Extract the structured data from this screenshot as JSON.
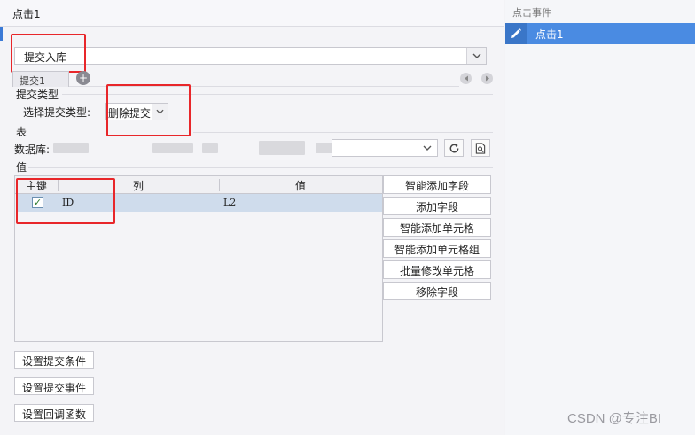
{
  "dialog": {
    "title": "点击1",
    "submit_select_value": "提交入库",
    "tab_label": "提交1",
    "add_tab_symbol": "+",
    "submit_type_section": "提交类型",
    "choose_submit_type_label": "选择提交类型:",
    "submit_type_value": "删除提交",
    "table_section": "表",
    "database_label": "数据库:",
    "values_section": "值",
    "columns": [
      "主键",
      "列",
      "值"
    ],
    "rows": [
      {
        "checked": true,
        "key_column": "ID",
        "value": "L2"
      }
    ],
    "side_buttons": [
      "智能添加字段",
      "添加字段",
      "智能添加单元格",
      "智能添加单元格组",
      "批量修改单元格",
      "移除字段"
    ],
    "bottom_buttons": [
      "设置提交条件",
      "设置提交事件",
      "设置回调函数"
    ]
  },
  "right_panel": {
    "header": "点击事件",
    "events": [
      "点击1"
    ]
  },
  "watermark": "CSDN @专注BI",
  "colors": {
    "accent": "#4a8be2",
    "highlight_red": "#e8262a",
    "row_selected": "#cfdcec"
  },
  "icons": [
    "refresh-icon",
    "preview-icon",
    "pencil-icon",
    "add-circle-icon",
    "chevron-down-icon",
    "arrow-left-icon",
    "arrow-right-icon",
    "checkmark-icon"
  ]
}
